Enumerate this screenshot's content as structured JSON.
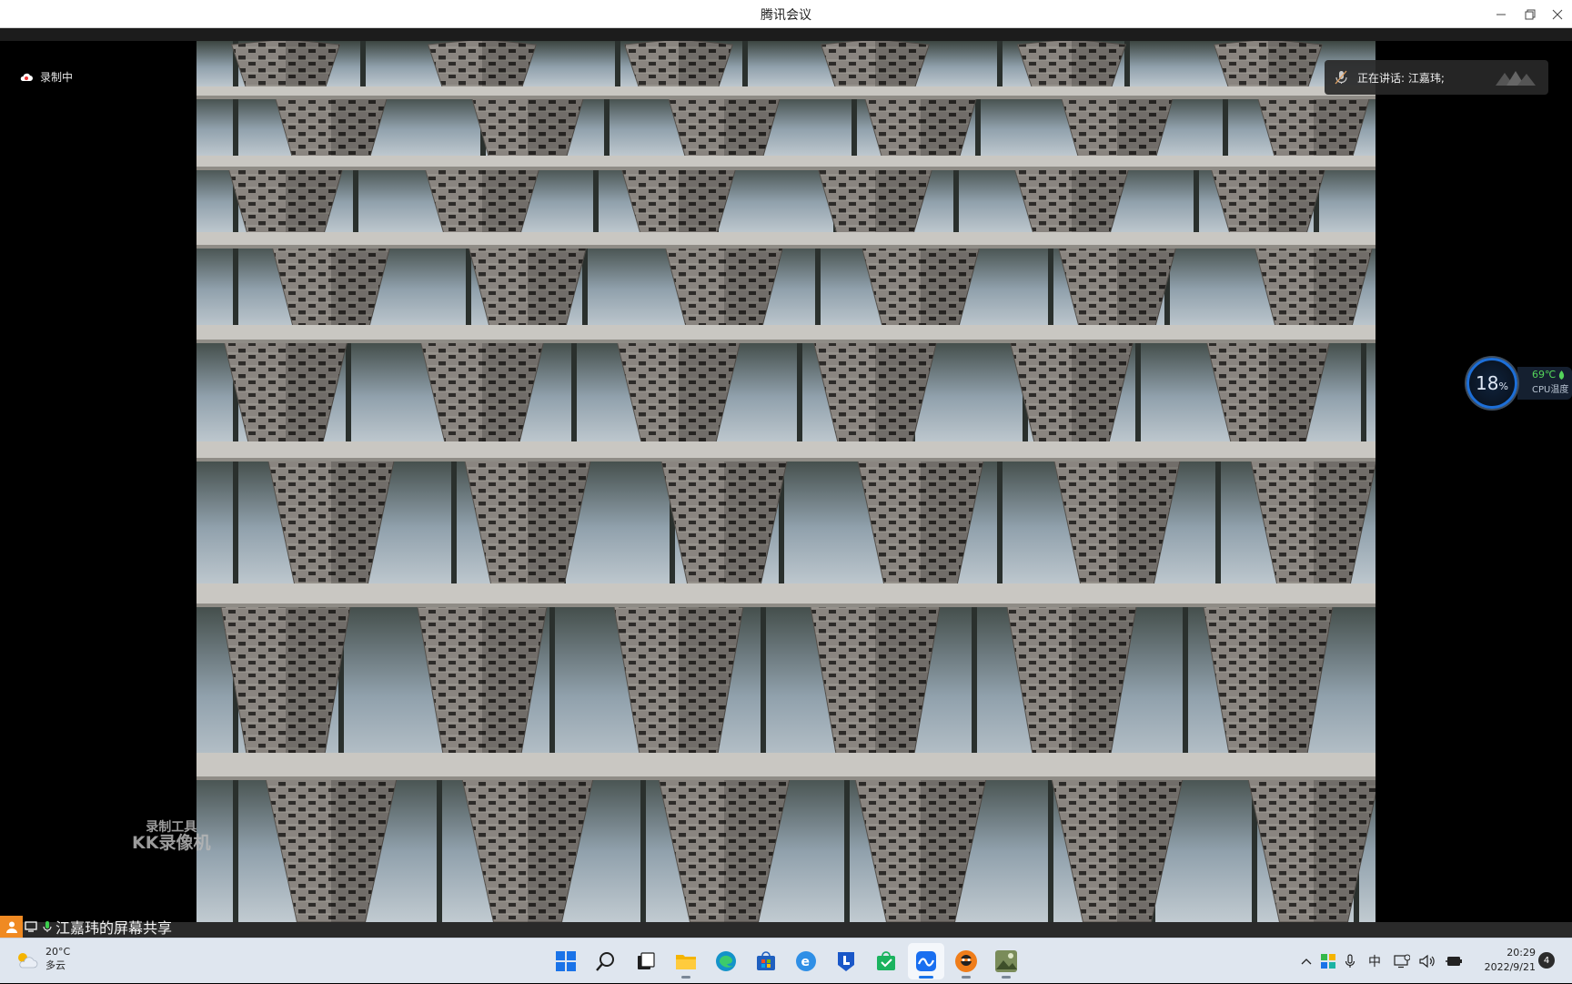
{
  "window": {
    "title": "腾讯会议"
  },
  "recording": {
    "label": "录制中"
  },
  "speaker": {
    "label": "正在讲话: 江嘉玮;"
  },
  "cpu_widget": {
    "usage": "18",
    "usage_unit": "%",
    "temperature": "69℃",
    "label": "CPU温度"
  },
  "watermark": {
    "line1": "录制工具",
    "line2": "KK录像机"
  },
  "share_status": {
    "label": "江嘉玮的屏幕共享"
  },
  "taskbar": {
    "weather": {
      "temp": "20°C",
      "condition": "多云"
    },
    "apps": [
      {
        "name": "start",
        "icon": "windows-logo-icon"
      },
      {
        "name": "search",
        "icon": "search-icon"
      },
      {
        "name": "task-view",
        "icon": "task-view-icon"
      },
      {
        "name": "file-explorer",
        "icon": "folder-icon"
      },
      {
        "name": "edge",
        "icon": "edge-icon"
      },
      {
        "name": "store",
        "icon": "store-icon"
      },
      {
        "name": "browser-e",
        "icon": "e-browser-icon"
      },
      {
        "name": "app-l",
        "icon": "l-app-icon"
      },
      {
        "name": "wechat-work",
        "icon": "green-bag-icon"
      },
      {
        "name": "tencent-meeting",
        "icon": "meeting-icon",
        "active": true
      },
      {
        "name": "kk-recorder",
        "icon": "recorder-icon"
      },
      {
        "name": "image-viewer",
        "icon": "image-icon"
      }
    ],
    "ime": "中",
    "clock": {
      "time": "20:29",
      "date": "2022/9/21"
    },
    "notifications": "4"
  },
  "colors": {
    "accent": "#1d6fd8",
    "share_badge": "#f08a22",
    "cpu_temp": "#54d45a"
  }
}
